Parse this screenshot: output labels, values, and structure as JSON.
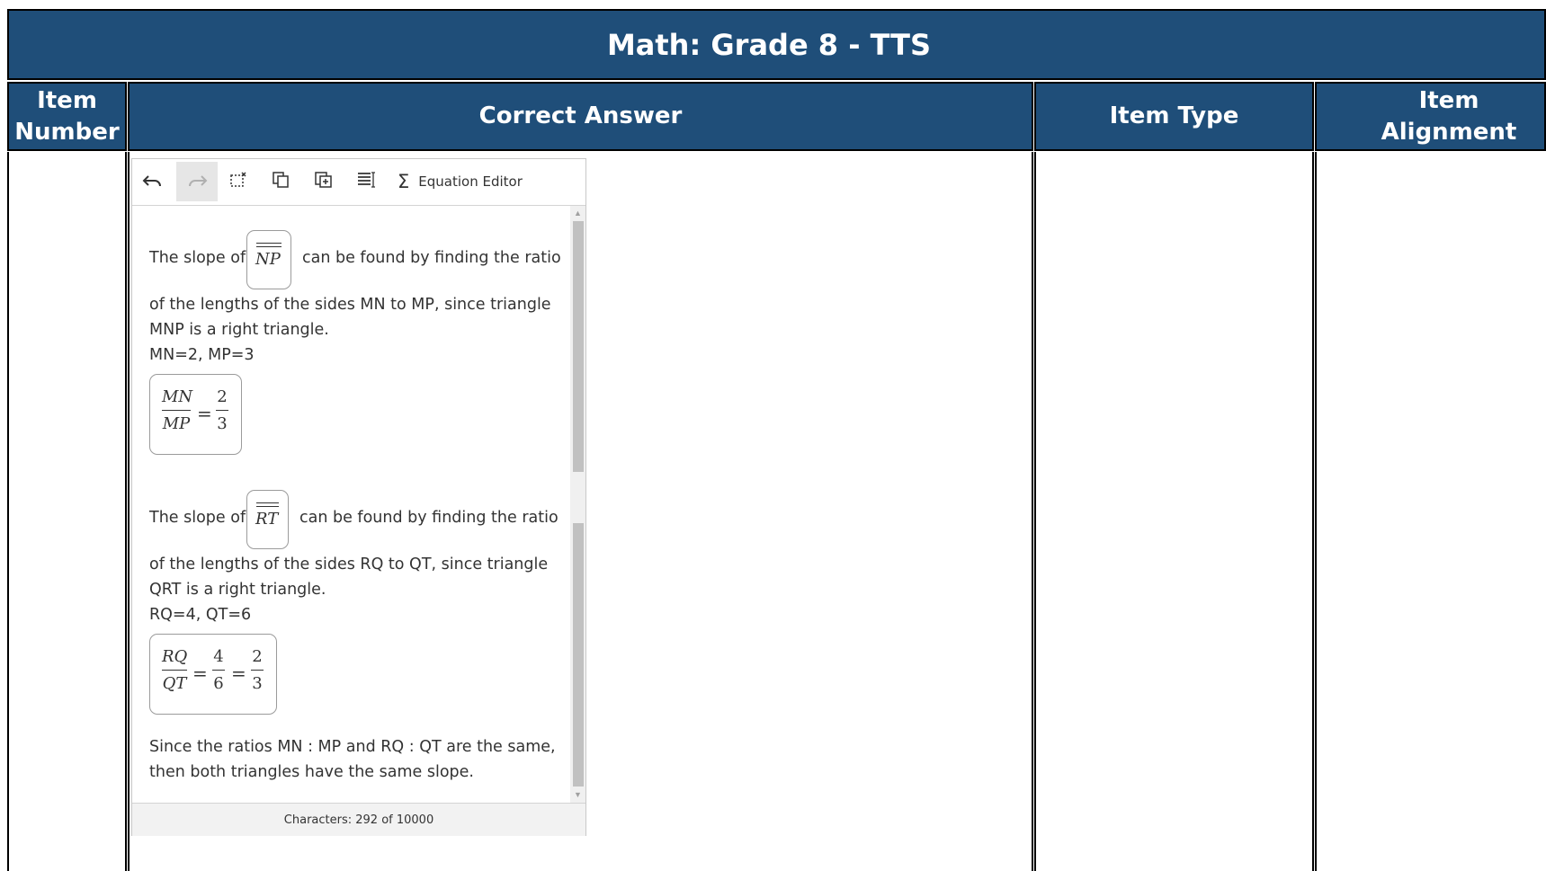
{
  "title": "Math: Grade 8 - TTS",
  "headers": {
    "item_number": "Item\nNumber",
    "correct_answer": "Correct Answer",
    "item_type": "Item Type",
    "item_alignment": "Item Alignment"
  },
  "editor": {
    "toolbar": {
      "undo_icon": "undo-icon",
      "redo_icon": "redo-icon",
      "equation_editor_label": "Equation Editor"
    },
    "content": {
      "p1_before": "The slope of",
      "p1_math": "NP",
      "p1_after": "can be found by finding the ratio",
      "p1_line2": "of the lengths of the sides MN to MP, since triangle",
      "p1_line3": "MNP is a right triangle.",
      "p1_values": "MN=2, MP=3",
      "frac1": {
        "num1": "MN",
        "den1": "MP",
        "eq": "=",
        "num2": "2",
        "den2": "3"
      },
      "p2_before": "The slope of",
      "p2_math": "RT",
      "p2_after": "can be found by finding the ratio",
      "p2_line2": "of the lengths of the sides RQ to QT, since triangle",
      "p2_line3": "QRT is a right triangle.",
      "p2_values": "RQ=4, QT=6",
      "frac2": {
        "num1": "RQ",
        "den1": "QT",
        "eq1": "=",
        "num2": "4",
        "den2": "6",
        "eq2": "=",
        "num3": "2",
        "den3": "3"
      },
      "conclusion_line1": "Since the ratios MN : MP and RQ : QT are the same,",
      "conclusion_line2": "then both triangles have the same slope."
    },
    "footer": "Characters: 292 of 10000"
  },
  "colors": {
    "header_bg": "#1f4e79",
    "header_text": "#ffffff"
  }
}
